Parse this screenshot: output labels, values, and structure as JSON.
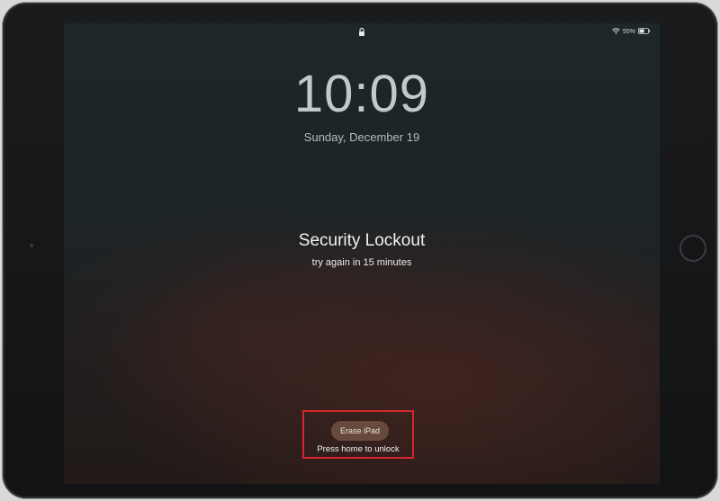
{
  "status_bar": {
    "lock_icon": "lock-icon",
    "wifi_icon": "wifi-icon",
    "battery_percent": "55%",
    "battery_icon": "battery-icon"
  },
  "lock_screen": {
    "time": "10:09",
    "date": "Sunday, December 19"
  },
  "lockout": {
    "title": "Security Lockout",
    "subtitle": "try again in 15 minutes"
  },
  "actions": {
    "erase_label": "Erase iPad",
    "home_hint": "Press home to unlock"
  },
  "colors": {
    "highlight": "#d7262b"
  }
}
